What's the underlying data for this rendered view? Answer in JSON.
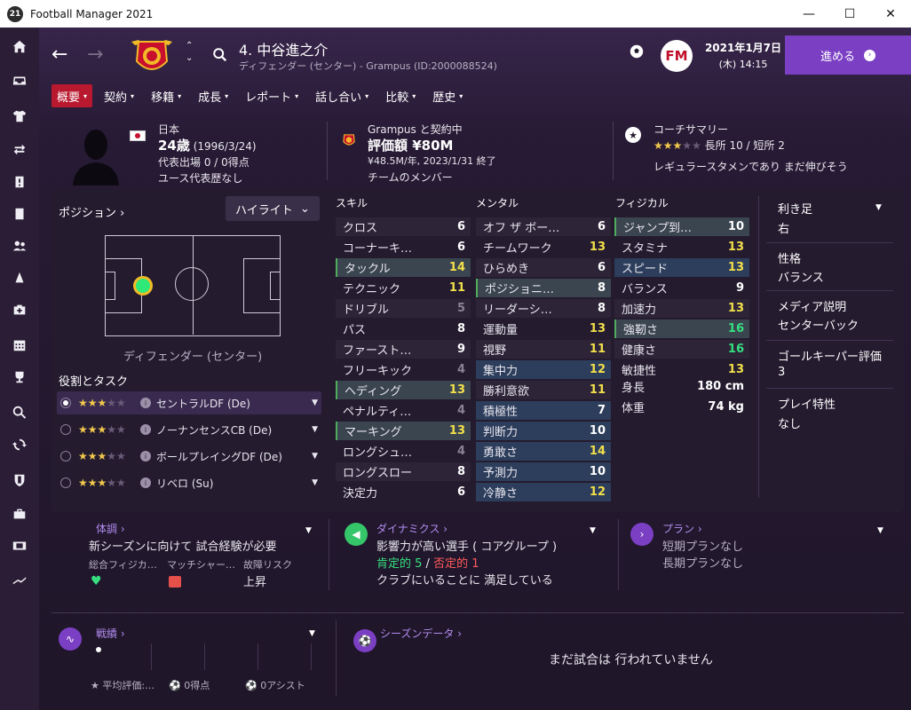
{
  "window": {
    "title": "Football Manager 2021",
    "logo_text": "21",
    "minimize": "—",
    "maximize": "☐",
    "close": "✕"
  },
  "sidebar": {
    "items": [
      "home-icon",
      "inbox-icon",
      "squad-icon",
      "transfers-icon",
      "dynamics-icon",
      "reports-icon",
      "staff-icon",
      "tactics-icon",
      "medical-icon",
      "schedule-icon",
      "competitions-icon",
      "search-icon",
      "swap-icon",
      "club-icon",
      "finance-icon",
      "scouting-icon",
      "stats-icon"
    ]
  },
  "header": {
    "player_name": "4. 中谷進之介",
    "player_sub": "ディフェンダー (センター) - Grampus (ID:2000088524)",
    "date_line1": "2021年1月7日",
    "date_line2": "(木) 14:15",
    "continue_label": "進める",
    "fm_logo": "FM"
  },
  "tabs": [
    {
      "label": "概要",
      "active": true
    },
    {
      "label": "契約"
    },
    {
      "label": "移籍"
    },
    {
      "label": "成長"
    },
    {
      "label": "レポート"
    },
    {
      "label": "話し合い"
    },
    {
      "label": "比較"
    },
    {
      "label": "歴史"
    }
  ],
  "overview": {
    "nation": "日本",
    "age": "24歳",
    "dob": "(1996/3/24)",
    "caps": "代表出場 0 / 0得点",
    "youth": "ユース代表歴なし",
    "contract_club": "Grampus と契約中",
    "value": "評価額 ¥80M",
    "wage": "¥48.5M/年, 2023/1/31 終了",
    "status": "チームのメンバー",
    "coach_title": "コーチサマリー",
    "coach_stars": 3,
    "coach_rating": "長所 10 / 短所 2",
    "coach_note": "レギュラースタメンであり まだ伸びそう"
  },
  "position": {
    "label": "ポジション",
    "highlight": "ハイライト",
    "position_name": "ディフェンダー (センター)",
    "roles_label": "役割とタスク",
    "roles": [
      {
        "name": "セントラルDF (De)",
        "stars": 3,
        "selected": true
      },
      {
        "name": "ノーナンセンスCB (De)",
        "stars": 3
      },
      {
        "name": "ボールプレイングDF (De)",
        "stars": 3
      },
      {
        "name": "リベロ (Su)",
        "stars": 3
      }
    ]
  },
  "attributes": {
    "technical_title": "スキル",
    "mental_title": "メンタル",
    "physical_title": "フィジカル",
    "technical": [
      {
        "name": "クロス",
        "value": "6",
        "c": "w"
      },
      {
        "name": "コーナーキ…",
        "value": "6",
        "c": "w"
      },
      {
        "name": "タックル",
        "value": "14",
        "c": "y",
        "hl": "green"
      },
      {
        "name": "テクニック",
        "value": "11",
        "c": "y"
      },
      {
        "name": "ドリブル",
        "value": "5",
        "c": "g"
      },
      {
        "name": "パス",
        "value": "8",
        "c": "w"
      },
      {
        "name": "ファースト…",
        "value": "9",
        "c": "w"
      },
      {
        "name": "フリーキック",
        "value": "4",
        "c": "g"
      },
      {
        "name": "ヘディング",
        "value": "13",
        "c": "y",
        "hl": "green"
      },
      {
        "name": "ペナルティ…",
        "value": "4",
        "c": "g"
      },
      {
        "name": "マーキング",
        "value": "13",
        "c": "y",
        "hl": "green"
      },
      {
        "name": "ロングシュ…",
        "value": "4",
        "c": "g"
      },
      {
        "name": "ロングスロー",
        "value": "8",
        "c": "w"
      },
      {
        "name": "決定力",
        "value": "6",
        "c": "w"
      }
    ],
    "mental": [
      {
        "name": "オフ ザ ボー…",
        "value": "6",
        "c": "w"
      },
      {
        "name": "チームワーク",
        "value": "13",
        "c": "y"
      },
      {
        "name": "ひらめき",
        "value": "6",
        "c": "w"
      },
      {
        "name": "ポジショニ…",
        "value": "8",
        "c": "w",
        "hl": "green"
      },
      {
        "name": "リーダーシ…",
        "value": "8",
        "c": "w"
      },
      {
        "name": "運動量",
        "value": "13",
        "c": "y"
      },
      {
        "name": "視野",
        "value": "11",
        "c": "y"
      },
      {
        "name": "集中力",
        "value": "12",
        "c": "y",
        "hl": "blue"
      },
      {
        "name": "勝利意欲",
        "value": "11",
        "c": "y"
      },
      {
        "name": "積極性",
        "value": "7",
        "c": "w",
        "hl": "blue"
      },
      {
        "name": "判断力",
        "value": "10",
        "c": "w",
        "hl": "blue"
      },
      {
        "name": "勇敢さ",
        "value": "14",
        "c": "y",
        "hl": "blue"
      },
      {
        "name": "予測力",
        "value": "10",
        "c": "w",
        "hl": "blue"
      },
      {
        "name": "冷静さ",
        "value": "12",
        "c": "y",
        "hl": "blue"
      }
    ],
    "physical": [
      {
        "name": "ジャンプ到…",
        "value": "10",
        "c": "w",
        "hl": "green"
      },
      {
        "name": "スタミナ",
        "value": "13",
        "c": "y"
      },
      {
        "name": "スピード",
        "value": "13",
        "c": "y",
        "hl": "blue"
      },
      {
        "name": "バランス",
        "value": "9",
        "c": "w"
      },
      {
        "name": "加速力",
        "value": "13",
        "c": "y"
      },
      {
        "name": "強靭さ",
        "value": "16",
        "c": "gr",
        "hl": "green"
      },
      {
        "name": "健康さ",
        "value": "16",
        "c": "gr"
      },
      {
        "name": "敏捷性",
        "value": "13",
        "c": "y"
      }
    ],
    "height_label": "身長",
    "height": "180 cm",
    "weight_label": "体重",
    "weight": "74 kg"
  },
  "bio": {
    "foot_label": "利き足",
    "foot": "右",
    "personality_label": "性格",
    "personality": "バランス",
    "media_label": "メディア説明",
    "media": "センターバック",
    "gk_label": "ゴールキーパー評価",
    "gk": "3",
    "traits_label": "プレイ特性",
    "traits": "なし"
  },
  "condition": {
    "title": "体調",
    "text": "新シーズンに向けて 試合経験が必要",
    "fitness_label": "総合フィジカ…",
    "sharpness_label": "マッチシャー…",
    "injury_label": "故障リスク",
    "injury_value": "上昇"
  },
  "dynamics": {
    "title": "ダイナミクス",
    "influence": "影響力が高い選手 ( コアグループ )",
    "positive": "肯定的 5",
    "sep": "/",
    "negative": "否定的 1",
    "happiness": "クラブにいることに 満足している"
  },
  "plans": {
    "title": "プラン",
    "short": "短期プランなし",
    "long": "長期プランなし"
  },
  "form": {
    "title": "戦績",
    "avg_rating": "平均評価:…",
    "goals": "0得点",
    "assists": "0アシスト"
  },
  "season": {
    "title": "シーズンデータ",
    "empty": "まだ試合は 行われていません"
  },
  "colors": {
    "accent": "#7b3fc4",
    "tab_active": "#b8192e",
    "highlight_value": "#f2e04a",
    "high_value": "#35e07f"
  }
}
